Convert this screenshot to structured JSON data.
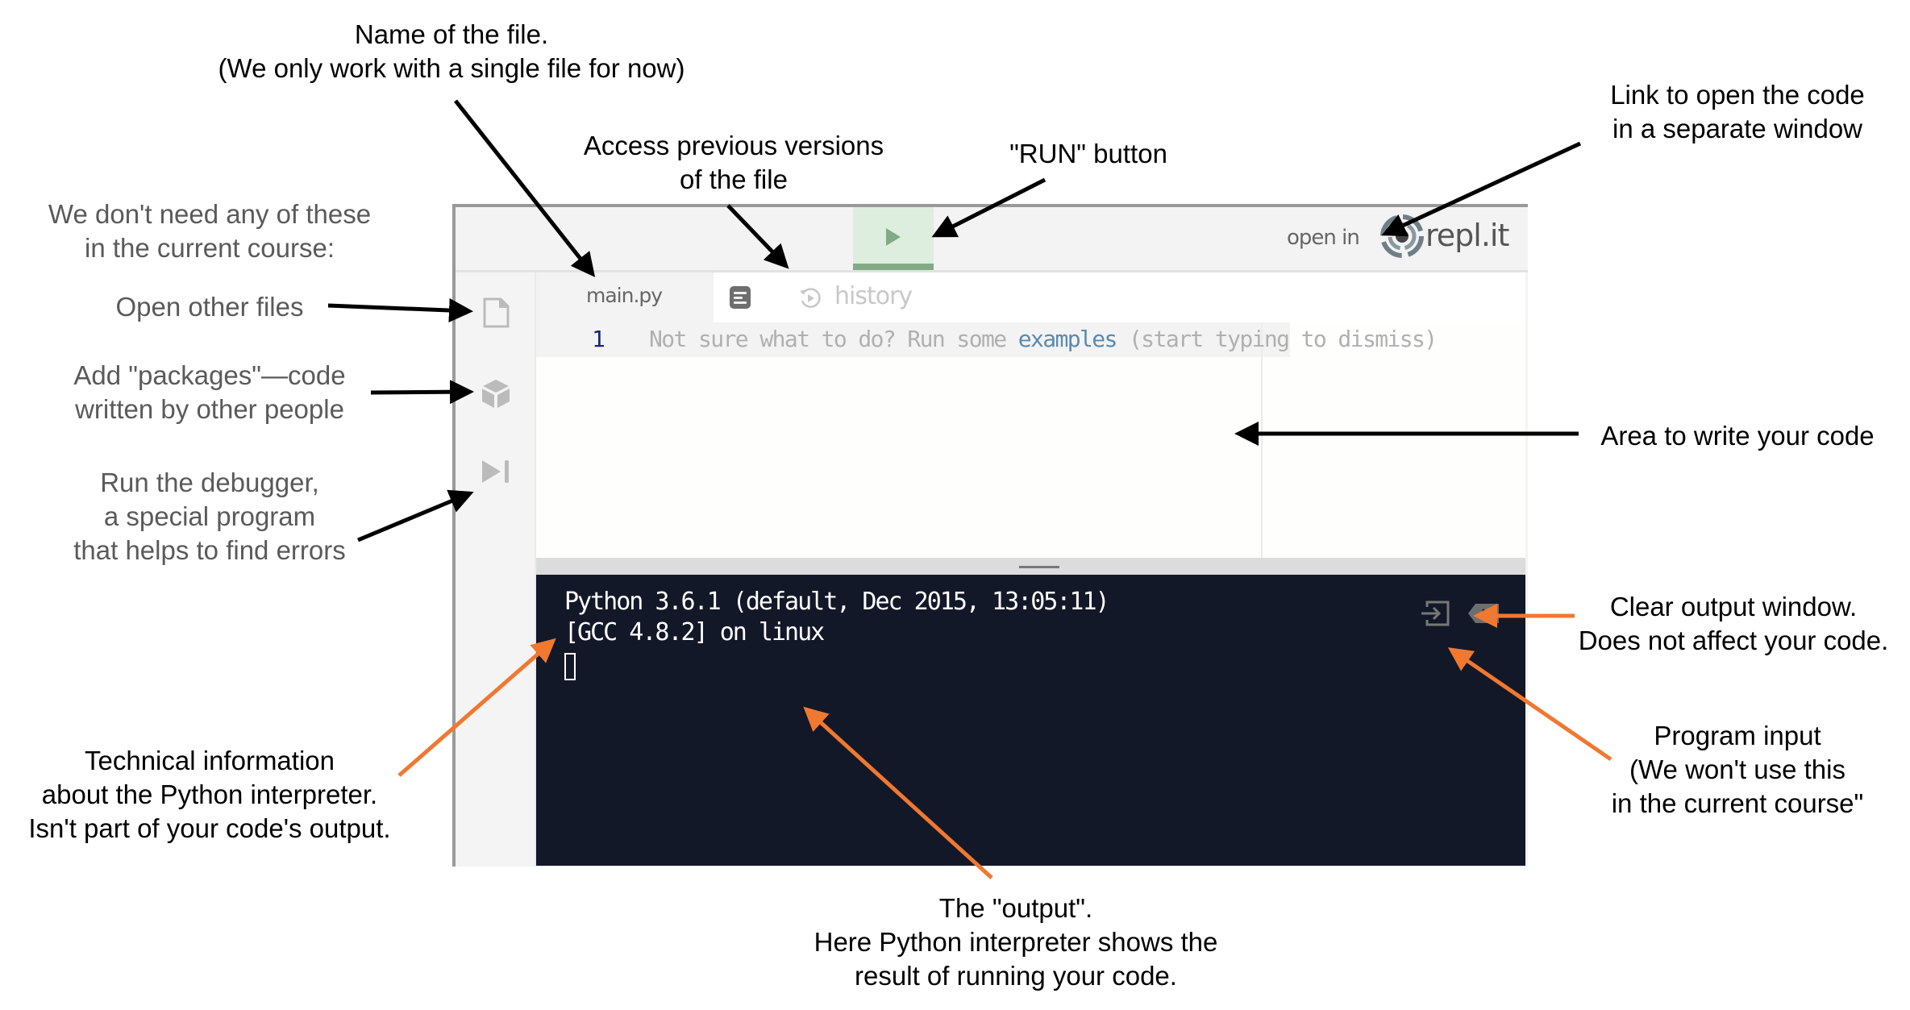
{
  "ide": {
    "header": {
      "run_button_label": "Run",
      "open_in_label": "open in",
      "brand_name": "repl.it"
    },
    "sidebar": {
      "items": [
        {
          "name": "files",
          "icon": "file-icon"
        },
        {
          "name": "packages",
          "icon": "package-cube-icon"
        },
        {
          "name": "debugger",
          "icon": "debugger-step-icon"
        }
      ]
    },
    "tabs": {
      "file_name": "main.py",
      "history_label": "history"
    },
    "editor": {
      "line_number": "1",
      "hint_prefix": "Not sure what to do? Run some ",
      "hint_link": "examples",
      "hint_suffix": " (start typing to dismiss)"
    },
    "terminal": {
      "line1": "Python 3.6.1 (default, Dec 2015, 13:05:11)",
      "line2": "[GCC 4.8.2] on linux"
    }
  },
  "annotations": {
    "file_name": "Name of the file.\n(We only work with a single file for now)",
    "history": "Access previous versions\nof the file",
    "run": "\"RUN\" button",
    "open_link": "Link to open the code\nin a separate window",
    "not_needed": "We don't need any of these\nin the current course:",
    "open_files": "Open other files",
    "packages": "Add \"packages\"—code\nwritten by other people",
    "debugger": "Run the debugger,\na special program\nthat helps to find errors",
    "code_area": "Area to write your code",
    "clear_output": "Clear output window.\nDoes not affect your code.",
    "program_input": "Program input\n(We won't use this\nin the current course\"",
    "tech_info": "Technical information\nabout the Python interpreter.\nIsn't part of your code's output.",
    "output": "The \"output\".\nHere Python interpreter shows the\nresult of running your code."
  },
  "colors": {
    "run_green": "#82ab85",
    "run_bg": "#deeede",
    "terminal_bg": "#121828",
    "arrow_black": "#000000",
    "arrow_orange": "#f07830",
    "link_blue": "#5a8ab0"
  }
}
